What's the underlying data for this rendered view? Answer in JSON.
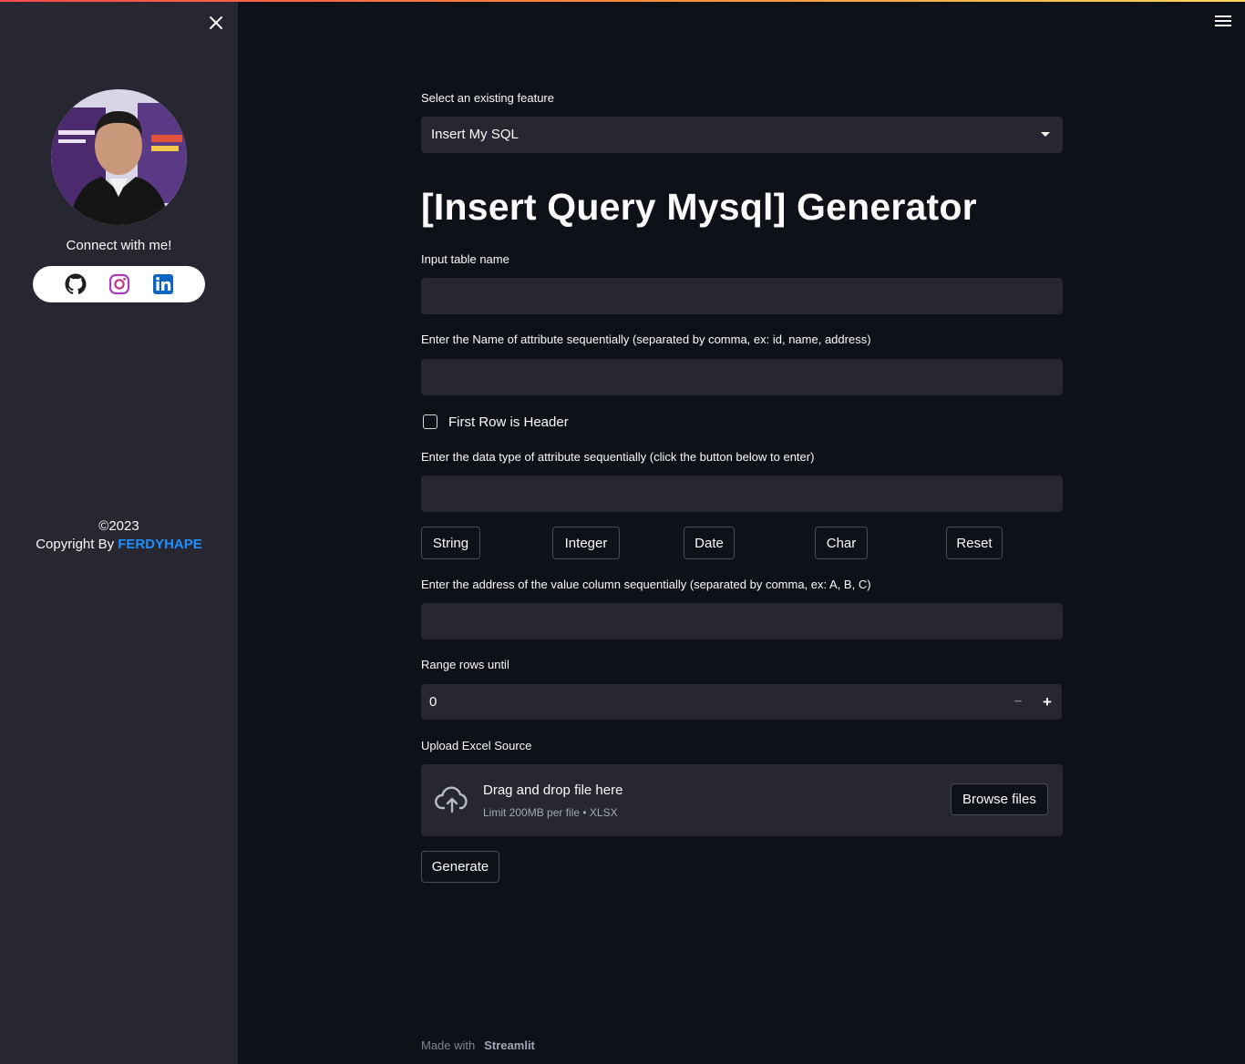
{
  "sidebar": {
    "connect_text": "Connect with me!",
    "social": [
      "github-icon",
      "instagram-icon",
      "linkedin-icon"
    ],
    "copyright_year": "©2023",
    "copyright_prefix": "Copyright By ",
    "copyright_brand": "FERDYHAPE"
  },
  "main": {
    "feature_label": "Select an existing feature",
    "feature_selected": "Insert My SQL",
    "title": "[Insert Query Mysql] Generator",
    "table_name_label": "Input table name",
    "table_name_value": "",
    "attr_name_label": "Enter the Name of attribute sequentially (separated by comma, ex: id, name, address)",
    "attr_name_value": "",
    "first_row_header_label": "First Row is Header",
    "first_row_header_checked": false,
    "data_type_label": "Enter the data type of attribute sequentially (click the button below to enter)",
    "data_type_value": "",
    "type_buttons": [
      "String",
      "Integer",
      "Date",
      "Char",
      "Reset"
    ],
    "value_col_label": "Enter the address of the value column sequentially (separated by comma, ex: A, B, C)",
    "value_col_value": "",
    "range_label": "Range rows until",
    "range_value": "0",
    "stepper_minus": "−",
    "stepper_plus": "+",
    "upload_label": "Upload Excel Source",
    "drop_title": "Drag and drop file here",
    "drop_limit": "Limit 200MB per file • XLSX",
    "browse_label": "Browse files",
    "generate_label": "Generate"
  },
  "footer": {
    "made_with": "Made with",
    "brand": "Streamlit"
  },
  "colors": {
    "background": "#0e1117",
    "sidebar": "#262730",
    "input": "#262730",
    "accent_link": "#1f8fff",
    "stripe_start": "#ff4b4b",
    "stripe_end": "#ffd65b"
  }
}
